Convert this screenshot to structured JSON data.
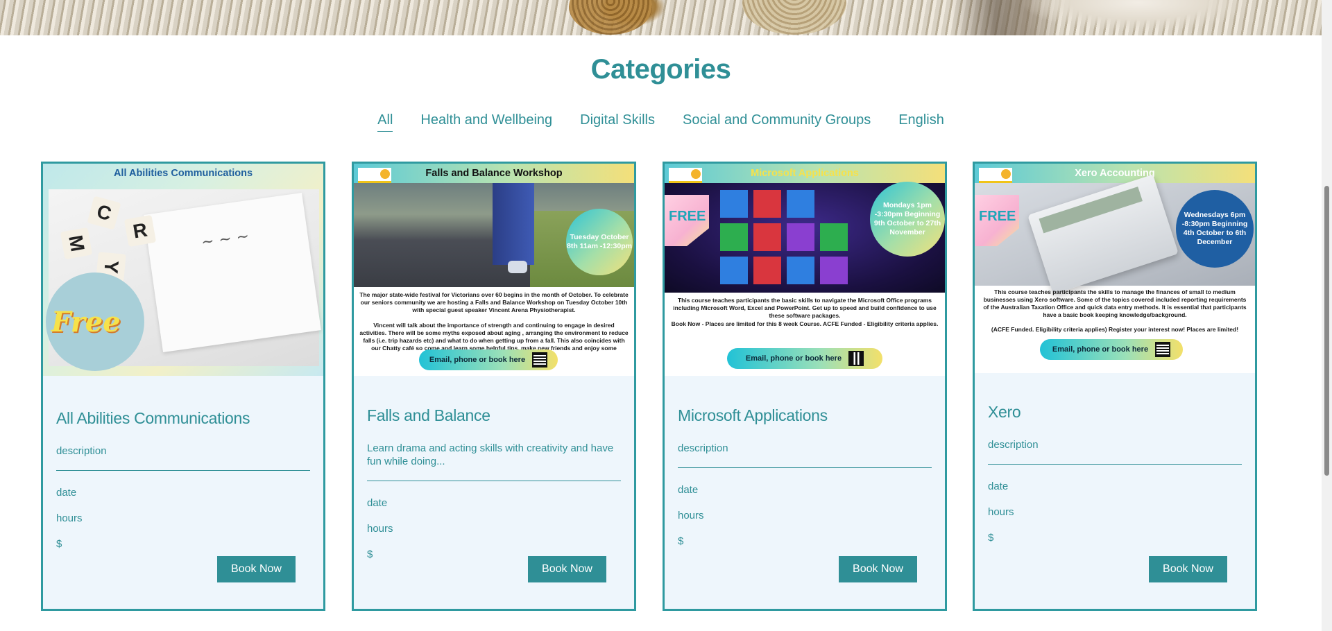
{
  "page": {
    "heading": "Categories",
    "tabs": [
      {
        "label": "All",
        "active": true
      },
      {
        "label": "Health and Wellbeing",
        "active": false
      },
      {
        "label": "Digital Skills",
        "active": false
      },
      {
        "label": "Social and Community Groups",
        "active": false
      },
      {
        "label": "English",
        "active": false
      }
    ]
  },
  "colors": {
    "accent": "#2f8f96",
    "card_bg": "#eef6fc",
    "card_border": "#2f9aa0"
  },
  "cards": [
    {
      "poster": {
        "header": "All Abilities Communications",
        "free": "Free"
      },
      "title": "All Abilities Communications",
      "description": "description",
      "date": "date",
      "hours": "hours",
      "price": "$",
      "button": "Book Now"
    },
    {
      "poster": {
        "header": "Falls and Balance Workshop",
        "date_badge": "Tuesday October 8th 11am -12:30pm",
        "text1": "The major state-wide festival for Victorians over 60 begins in the month of October. To celebrate our seniors community we are hosting a Falls and Balance Workshop on Tuesday October 10th with special guest speaker Vincent Arena Physiotherapist.",
        "text2": "Vincent will talk about the importance of strength and continuing to engage in desired activities. There will be some myths exposed about aging , arranging the environment to reduce falls (i.e. trip hazards etc) and what to do when getting up from a fall. This also coincides with our Chatty café so come and learn some helpful tips, make new friends and enjoy some delicious morning tea.",
        "cta": "Email, phone or book here"
      },
      "title": "Falls and Balance",
      "description": "Learn drama and acting skills with creativity and have fun while doing...",
      "date": "date",
      "hours": "hours",
      "price": "$",
      "button": "Book Now"
    },
    {
      "poster": {
        "header": "Microsoft Applications",
        "free": "FREE",
        "date_badge": "Mondays 1pm -3:30pm Beginning 9th October to 27th November",
        "text1": "This course teaches participants the basic skills to navigate the Microsoft Office programs including Microsoft Word, Excel and PowerPoint. Get up to speed and build confidence to use these software packages.",
        "text2": "Book Now - Places are limited for this 8 week Course. ACFE Funded - Eligibility criteria applies.",
        "cta": "Email, phone or book here"
      },
      "title": "Microsoft Applications",
      "description": "description",
      "date": "date",
      "hours": "hours",
      "price": "$",
      "button": "Book Now"
    },
    {
      "poster": {
        "header": "Xero Accounting",
        "free": "FREE",
        "date_badge": "Wednesdays 6pm -8:30pm Beginning 4th October to 6th December",
        "text1": "This course teaches participants the skills to manage the finances of small to medium businesses using Xero software. Some of the topics covered included reporting requirements of the Australian Taxation Office and quick data entry methods. It is essential that participants have a basic book keeping knowledge/background.",
        "text2": "(ACFE Funded. Eligibility criteria applies) Register your interest now! Places are limited!",
        "cta": "Email, phone or book here"
      },
      "title": "Xero",
      "description": "description",
      "date": "date",
      "hours": "hours",
      "price": "$",
      "button": "Book Now"
    }
  ]
}
